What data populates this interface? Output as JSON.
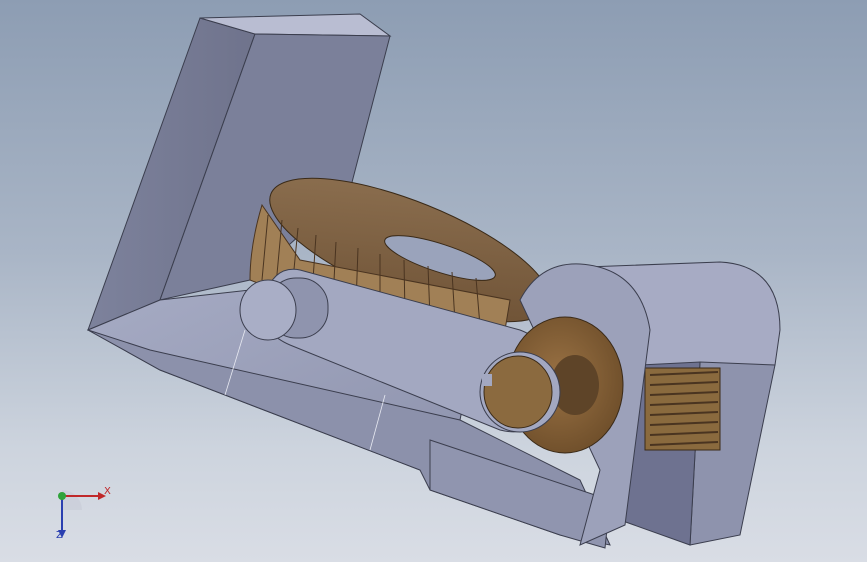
{
  "viewport": {
    "background_top": "#8d9db3",
    "background_bottom": "#d9dde5"
  },
  "model": {
    "body_color": "#9ea3bc",
    "gear_color": "#8a6a45",
    "washer_color": "#7e5a32"
  },
  "triad": {
    "x_label": "X",
    "z_label": "Z",
    "x_color": "#c0282a",
    "y_color": "#2fa33a",
    "z_color": "#2a3fb0"
  }
}
